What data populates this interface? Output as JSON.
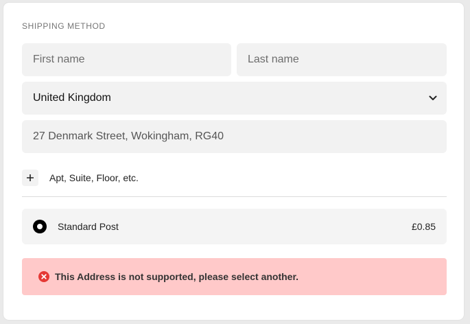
{
  "section_title": "SHIPPING METHOD",
  "fields": {
    "first_name": {
      "value": "",
      "placeholder": "First name"
    },
    "last_name": {
      "value": "",
      "placeholder": "Last name"
    },
    "country": {
      "selected": "United Kingdom"
    },
    "address": {
      "value": "27 Denmark Street, Wokingham, RG40",
      "placeholder": ""
    }
  },
  "apt": {
    "icon": "plus-icon",
    "label": "Apt, Suite, Floor, etc."
  },
  "shipping_option": {
    "name": "Standard Post",
    "price": "£0.85",
    "selected": true
  },
  "error": {
    "icon": "error-x-icon",
    "message": "This Address is not supported, please select another.",
    "color": "#e53935"
  },
  "colors": {
    "field_bg": "#f2f2f2",
    "error_bg": "#ffc9c9"
  }
}
